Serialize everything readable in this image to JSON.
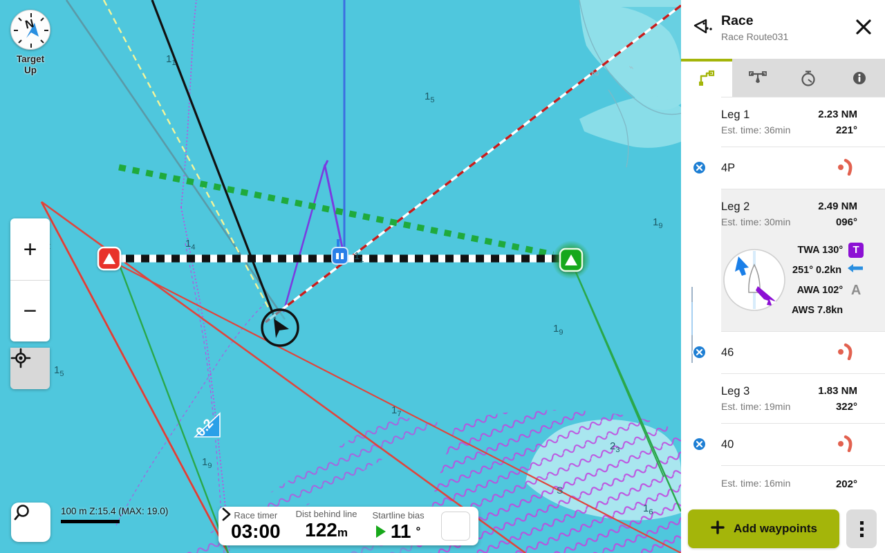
{
  "panel": {
    "title": "Race",
    "subtitle": "Race Route031",
    "header_icon": "route-icon",
    "close_icon": "close-icon",
    "tabs": [
      {
        "name": "route",
        "icon": "route-plan-icon",
        "active": true
      },
      {
        "name": "startline",
        "icon": "startline-icon",
        "active": false
      },
      {
        "name": "timer",
        "icon": "stopwatch-icon",
        "active": false
      },
      {
        "name": "info",
        "icon": "info-icon",
        "active": false
      }
    ]
  },
  "route": {
    "items": [
      {
        "kind": "leg",
        "name": "Leg 1",
        "est_time": "Est. time: 36min",
        "distance": "2.23 NM",
        "bearing": "221°",
        "selected": false
      },
      {
        "kind": "waypoint",
        "name": "4P",
        "icon": "mark-rounding-icon",
        "node_icon": "close-circle-icon"
      },
      {
        "kind": "leg",
        "name": "Leg 2",
        "est_time": "Est. time: 30min",
        "distance": "2.49 NM",
        "bearing": "096°",
        "selected": true,
        "wind": {
          "polar_icon": "boat-polar-icon",
          "twa": "TWA 130°",
          "twa_badge": "T",
          "current": "251° 0.2kn",
          "current_icon": "current-arrow-icon",
          "awa": "AWA 102°",
          "awa_badge": "A",
          "aws": "AWS 7.8kn"
        }
      },
      {
        "kind": "waypoint",
        "name": "46",
        "icon": "mark-rounding-icon",
        "node_icon": "close-circle-icon"
      },
      {
        "kind": "leg",
        "name": "Leg 3",
        "est_time": "Est. time: 19min",
        "distance": "1.83 NM",
        "bearing": "322°",
        "selected": false
      },
      {
        "kind": "waypoint",
        "name": "40",
        "icon": "mark-rounding-icon",
        "node_icon": "close-circle-icon"
      },
      {
        "kind": "leg",
        "name": "",
        "est_time": "Est. time: 16min",
        "distance": "",
        "bearing": "202°",
        "selected": false,
        "partial": true
      }
    ]
  },
  "actions": {
    "add_waypoints": "Add waypoints",
    "add_icon": "plus-icon",
    "more_icon": "kebab-menu-icon"
  },
  "map": {
    "orientation_label_line1": "Target",
    "orientation_label_line2": "Up",
    "compass_icon": "compass-north-icon",
    "zoom_in": "+",
    "zoom_out": "−",
    "locate_icon": "crosshair-locate-icon",
    "search_icon": "search-icon",
    "scale_text": "100 m Z:15.4 (MAX: 19.0)",
    "depth_soundings": [
      "1₁",
      "1₅",
      "1₉",
      "1₄",
      "1₅",
      "1₉",
      "1₉",
      "1₇",
      "1₉",
      "2₃",
      "1₆",
      "2",
      "S"
    ],
    "current_arrow_label": "0.2",
    "start_mark_port_icon": "red-triangle-mark",
    "start_mark_stbd_icon": "green-triangle-mark",
    "boat_icon": "own-boat-arrow",
    "waypoint_icon": "blue-buoy-icon"
  },
  "timer_bar": {
    "fields": [
      {
        "label": "Race timer",
        "value": "03:00",
        "unit": ""
      },
      {
        "label": "Dist behind line",
        "value": "122",
        "unit": "m"
      },
      {
        "label": "Startline bias",
        "value": "11",
        "unit": "°",
        "arrow": "right-triangle-green"
      }
    ],
    "next_icon": "chevron-right-icon"
  },
  "colors": {
    "accent": "#a4b50a",
    "water": "#4fc7dd",
    "shallow": "#8fdfe9",
    "route_blue": "#1e7fd4",
    "rail_dark": "#174a7c",
    "mark_red": "#e8322a",
    "mark_green": "#17a81a",
    "purple": "#8c10d4"
  }
}
